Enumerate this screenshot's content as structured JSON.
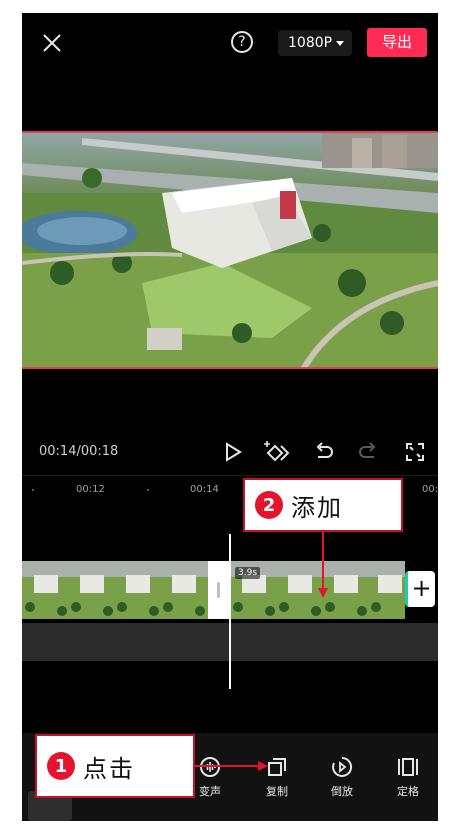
{
  "header": {
    "resolution": "1080P",
    "export_label": "导出"
  },
  "player": {
    "timecode": "00:14/00:18"
  },
  "ruler": {
    "ticks": [
      "00:12",
      "00:14",
      "00:"
    ]
  },
  "track": {
    "clip_duration": "3.9s"
  },
  "toolbar": {
    "tools": [
      {
        "label": "变声"
      },
      {
        "label": "复制"
      },
      {
        "label": "倒放"
      },
      {
        "label": "定格"
      }
    ]
  },
  "annotations": {
    "step1": {
      "number": "1",
      "text": "点击"
    },
    "step2": {
      "number": "2",
      "text": "添加"
    }
  },
  "colors": {
    "accent": "#fe2c55",
    "callout_border": "#c8102e",
    "playhead": "#ffffff"
  }
}
